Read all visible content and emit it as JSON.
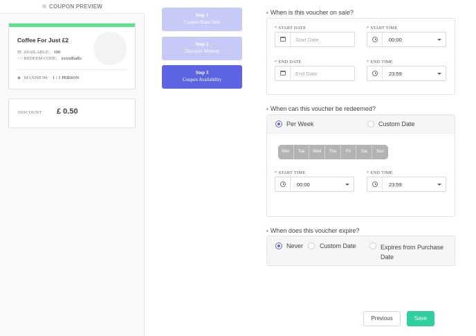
{
  "preview": {
    "header": "COUPON PREVIEW",
    "coupon_title": "Coffee For Just £2",
    "available_label": "AVAILABLE:",
    "available_value": "100",
    "redeem_label": "REDEEM CODE:",
    "redeem_value": "xxxxdfadfs",
    "maximum_label": "MAXIMUM:",
    "maximum_value": "1 / 1 PERSON",
    "discount_label": "DISCOUNT",
    "discount_value": "£ 0.50",
    "accent_color": "#5be38f"
  },
  "steps": [
    {
      "number": "Step 1",
      "label": "Coupon Basic Info",
      "active": false
    },
    {
      "number": "Step 2",
      "label": "Discount Method",
      "active": false
    },
    {
      "number": "Step 3",
      "label": "Coupon Availability",
      "active": true
    }
  ],
  "sale": {
    "question": "When is this voucher on sale?",
    "start_date_label": "START DATE",
    "start_date_placeholder": "Start Date",
    "start_time_label": "START TIME",
    "start_time_value": "00:00",
    "end_date_label": "END DATE",
    "end_date_placeholder": "End Date",
    "end_time_label": "END TIME",
    "end_time_value": "23:59"
  },
  "redeem": {
    "question": "When can this voucher be redeemed?",
    "option_per_week": "Per Week",
    "option_custom_date": "Custom Date",
    "selected": "Per Week",
    "days": [
      "Mon",
      "Tue",
      "Wed",
      "Thu",
      "Fri",
      "Sat",
      "Sun"
    ],
    "start_time_label": "START TIME",
    "start_time_value": "00:00",
    "end_time_label": "END TIME",
    "end_time_value": "23:59"
  },
  "expire": {
    "question": "When does this voucher expire?",
    "option_never": "Never",
    "option_custom_date": "Custom Date",
    "option_expires_line1": "Expires from Purchase",
    "option_expires_line2": "Date",
    "selected": "Never"
  },
  "actions": {
    "previous": "Previous",
    "save": "Save",
    "primary_color": "#5c64e3",
    "save_color": "#2fd09e"
  },
  "icons": [
    "calendar-icon",
    "clock-icon",
    "chevron-down-icon",
    "building-icon",
    "code-icon",
    "tag-icon"
  ]
}
